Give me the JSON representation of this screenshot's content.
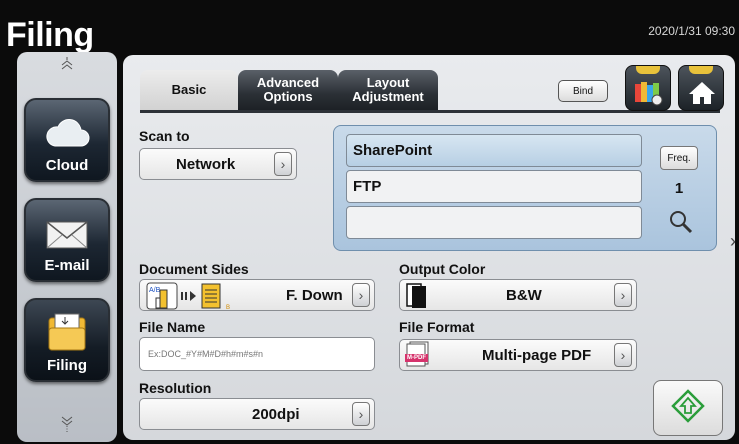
{
  "app": {
    "title": "Filing",
    "datetime": "2020/1/31 09:30"
  },
  "sidebar": {
    "items": [
      {
        "label": "Cloud",
        "icon": "cloud-icon"
      },
      {
        "label": "E-mail",
        "icon": "envelope-icon"
      },
      {
        "label": "Filing",
        "icon": "folder-icon"
      }
    ],
    "up_icon": "chevron-up-icon",
    "down_icon": "chevron-down-icon"
  },
  "tabs": [
    {
      "label": "Basic"
    },
    {
      "label": "Advanced Options"
    },
    {
      "label": "Layout Adjustment"
    }
  ],
  "header": {
    "bind_label": "Bind",
    "icons": [
      "profile-settings-icon",
      "home-icon"
    ]
  },
  "scan_to": {
    "label": "Scan to",
    "value": "Network"
  },
  "destinations": {
    "items": [
      "SharePoint",
      "FTP",
      ""
    ],
    "freq_label": "Freq.",
    "count": "1",
    "search_icon": "magnifier-icon"
  },
  "document_sides": {
    "label": "Document Sides",
    "value": "F. Down"
  },
  "output_color": {
    "label": "Output Color",
    "value": "B&W"
  },
  "file_name": {
    "label": "File Name",
    "placeholder": "Ex:DOC_#Y#M#D#h#m#s#n"
  },
  "file_format": {
    "label": "File Format",
    "value": "Multi-page PDF",
    "icon_label": "M-PDF"
  },
  "resolution": {
    "label": "Resolution",
    "value": "200dpi"
  },
  "start": {
    "icon": "start-diamond-icon"
  },
  "colors": {
    "accent_green": "#2a9d3a",
    "brand_yellow": "#e8c23b",
    "selected_blue": "#aac4dd"
  }
}
